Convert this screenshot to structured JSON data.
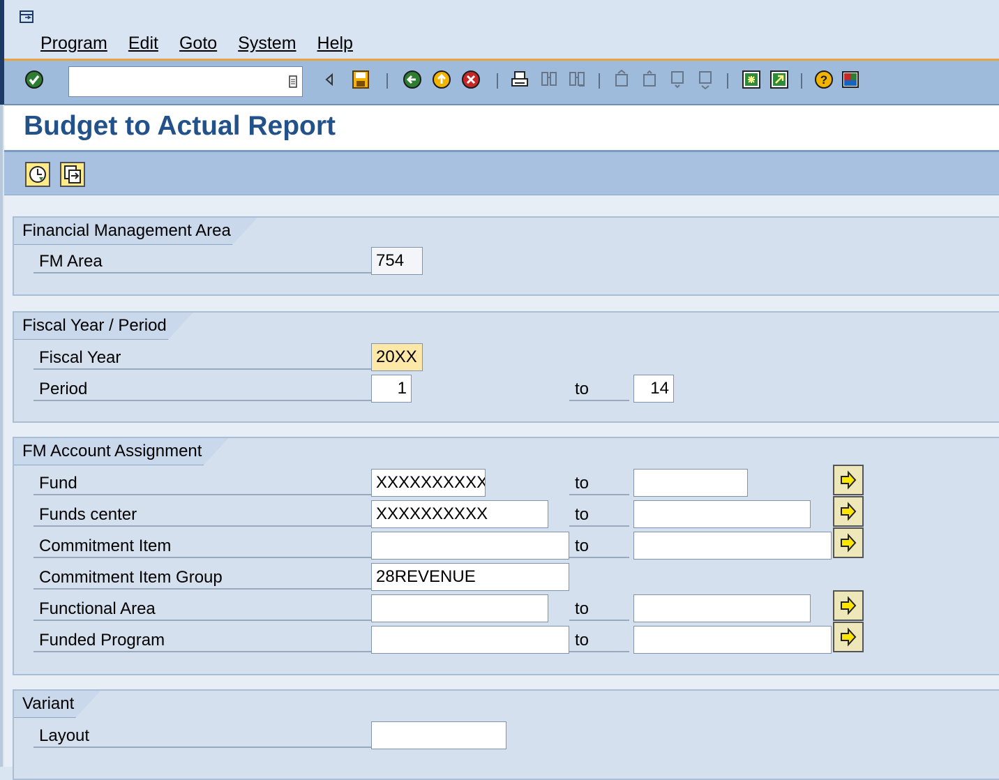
{
  "menu": {
    "items": [
      {
        "label": "Program"
      },
      {
        "label": "Edit"
      },
      {
        "label": "Goto"
      },
      {
        "label": "System"
      },
      {
        "label": "Help"
      }
    ]
  },
  "toolbar": {
    "command_field_value": "",
    "icons": [
      "enter-icon",
      "back-arrow-icon",
      "save-icon",
      "back-icon",
      "exit-icon",
      "cancel-icon",
      "print-icon",
      "find-icon",
      "find-next-icon",
      "first-page-icon",
      "previous-page-icon",
      "next-page-icon",
      "last-page-icon",
      "new-session-icon",
      "shortcut-icon",
      "help-icon",
      "customize-layout-icon"
    ]
  },
  "title": "Budget to Actual Report",
  "app_toolbar": {
    "icons": [
      "execute-icon",
      "get-variant-icon"
    ]
  },
  "groups": {
    "fm_area": {
      "title": "Financial Management Area",
      "fm_area_label": "FM Area",
      "fm_area_value": "754"
    },
    "fiscal": {
      "title": "Fiscal Year / Period",
      "fiscal_year_label": "Fiscal Year",
      "fiscal_year_value": "20XX",
      "period_label": "Period",
      "period_from": "1",
      "to_label": "to",
      "period_to": "14"
    },
    "account": {
      "title": "FM Account Assignment",
      "to_label": "to",
      "fund_label": "Fund",
      "fund_from": "XXXXXXXXXX",
      "fund_to": "",
      "funds_center_label": "Funds center",
      "funds_center_from": "XXXXXXXXXX",
      "funds_center_to": "",
      "commitment_item_label": "Commitment Item",
      "commitment_item_from": "",
      "commitment_item_to": "",
      "commitment_group_label": "Commitment Item Group",
      "commitment_group_value": "28REVENUE",
      "functional_area_label": "Functional Area",
      "functional_area_from": "",
      "functional_area_to": "",
      "funded_program_label": "Funded Program",
      "funded_program_from": "",
      "funded_program_to": ""
    },
    "variant": {
      "title": "Variant",
      "layout_label": "Layout",
      "layout_value": ""
    }
  },
  "colors": {
    "title": "#23518a",
    "required_field": "#fde8a7",
    "toolbar": "#9fbbdb",
    "accent_line": "#e8a33d"
  }
}
